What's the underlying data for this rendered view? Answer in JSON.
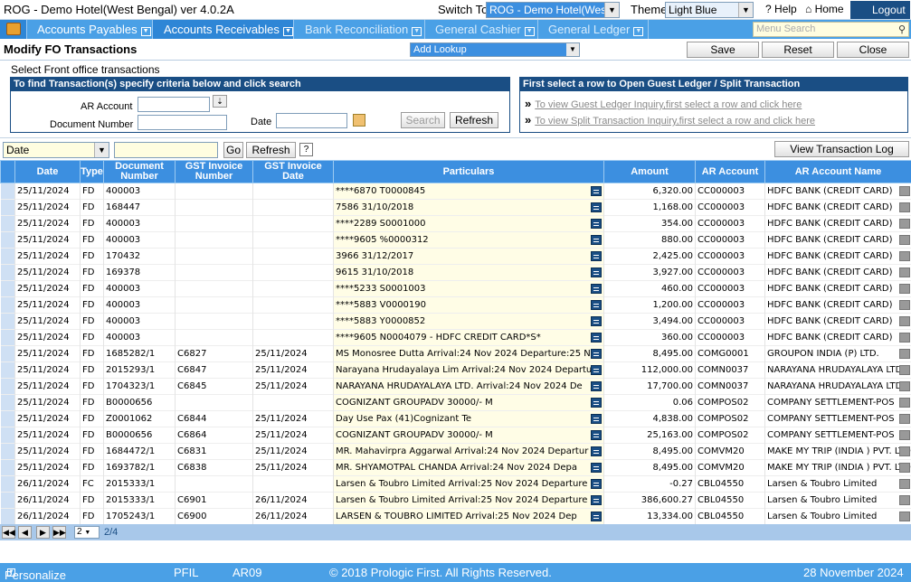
{
  "window": {
    "title": "ROG - Demo Hotel(West Bengal) ver 4.0.2A",
    "switch_to_label": "Switch To",
    "switch_to_value": "ROG - Demo Hotel(West",
    "theme_label": "Theme",
    "theme_value": "Light Blue",
    "help_label": "Help",
    "home_label": "Home",
    "logout_label": "Logout"
  },
  "menu": {
    "items": [
      {
        "label": "Accounts Payables"
      },
      {
        "label": "Accounts Receivables"
      },
      {
        "label": "Bank Reconciliation"
      },
      {
        "label": "General Cashier"
      },
      {
        "label": "General Ledger"
      }
    ],
    "search_placeholder": "Menu Search"
  },
  "page": {
    "title": "Modify FO Transactions",
    "lookup_value": "Add Lookup",
    "save_label": "Save",
    "reset_label": "Reset",
    "close_label": "Close"
  },
  "criteria": {
    "caption": "Select Front office transactions",
    "left_header": "To find Transaction(s) specify criteria below and click search",
    "ar_account_label": "AR Account",
    "document_number_label": "Document Number",
    "date_label": "Date",
    "search_label": "Search",
    "refresh_label": "Refresh",
    "right_header": "First select a row to Open Guest Ledger / Split Transaction",
    "guest_ledger_link": "To view Guest Ledger Inquiry,first select a row and click here",
    "split_link": "To view Split Transaction Inquiry,first select a row and click here"
  },
  "filter": {
    "field_value": "Date",
    "go_label": "Go",
    "refresh_label": "Refresh",
    "help_label": "?",
    "view_log_label": "View Transaction Log"
  },
  "grid": {
    "columns": [
      "Date",
      "Type",
      "Document Number",
      "GST Invoice Number",
      "GST Invoice Date",
      "Particulars",
      "Amount",
      "AR Account",
      "AR Account Name"
    ],
    "rows": [
      [
        "25/11/2024",
        "FD",
        "400003",
        "",
        "",
        "****6870 T0000845",
        "6,320.00",
        "CC000003",
        "HDFC BANK (CREDIT CARD)"
      ],
      [
        "25/11/2024",
        "FD",
        "168447",
        "",
        "",
        "7586 31/10/2018",
        "1,168.00",
        "CC000003",
        "HDFC BANK (CREDIT CARD)"
      ],
      [
        "25/11/2024",
        "FD",
        "400003",
        "",
        "",
        "****2289 S0001000",
        "354.00",
        "CC000003",
        "HDFC BANK (CREDIT CARD)"
      ],
      [
        "25/11/2024",
        "FD",
        "400003",
        "",
        "",
        "****9605 %0000312",
        "880.00",
        "CC000003",
        "HDFC BANK (CREDIT CARD)"
      ],
      [
        "25/11/2024",
        "FD",
        "170432",
        "",
        "",
        "3966 31/12/2017",
        "2,425.00",
        "CC000003",
        "HDFC BANK (CREDIT CARD)"
      ],
      [
        "25/11/2024",
        "FD",
        "169378",
        "",
        "",
        "9615 31/10/2018",
        "3,927.00",
        "CC000003",
        "HDFC BANK (CREDIT CARD)"
      ],
      [
        "25/11/2024",
        "FD",
        "400003",
        "",
        "",
        "****5233 S0001003",
        "460.00",
        "CC000003",
        "HDFC BANK (CREDIT CARD)"
      ],
      [
        "25/11/2024",
        "FD",
        "400003",
        "",
        "",
        "****5883 V0000190",
        "1,200.00",
        "CC000003",
        "HDFC BANK (CREDIT CARD)"
      ],
      [
        "25/11/2024",
        "FD",
        "400003",
        "",
        "",
        "****5883 Y0000852",
        "3,494.00",
        "CC000003",
        "HDFC BANK (CREDIT CARD)"
      ],
      [
        "25/11/2024",
        "FD",
        "400003",
        "",
        "",
        "****9605 N0004079 - HDFC CREDIT CARD*S*",
        "360.00",
        "CC000003",
        "HDFC BANK (CREDIT CARD)"
      ],
      [
        "25/11/2024",
        "FD",
        "1685282/1",
        "C6827",
        "25/11/2024",
        "MS Monosree Dutta Arrival:24 Nov 2024  Departure:25 N",
        "8,495.00",
        "COMG0001",
        "GROUPON INDIA (P) LTD."
      ],
      [
        "25/11/2024",
        "FD",
        "2015293/1",
        "C6847",
        "25/11/2024",
        "Narayana Hrudayalaya Lim Arrival:24 Nov 2024  Departu",
        "112,000.00",
        "COMN0037",
        "NARAYANA HRUDAYALAYA LTD"
      ],
      [
        "25/11/2024",
        "FD",
        "1704323/1",
        "C6845",
        "25/11/2024",
        "NARAYANA HRUDAYALAYA LTD. Arrival:24 Nov 2024  De",
        "17,700.00",
        "COMN0037",
        "NARAYANA HRUDAYALAYA LTD"
      ],
      [
        "25/11/2024",
        "FD",
        "B0000656",
        "",
        "",
        "COGNIZANT GROUPADV 30000/- M",
        "0.06",
        "COMPOS02",
        "COMPANY SETTLEMENT-POS"
      ],
      [
        "25/11/2024",
        "FD",
        "Z0001062",
        "C6844",
        "25/11/2024",
        "Day Use Pax (41)Cognizant Te",
        "4,838.00",
        "COMPOS02",
        "COMPANY SETTLEMENT-POS"
      ],
      [
        "25/11/2024",
        "FD",
        "B0000656",
        "C6864",
        "25/11/2024",
        "COGNIZANT GROUPADV 30000/- M",
        "25,163.00",
        "COMPOS02",
        "COMPANY SETTLEMENT-POS"
      ],
      [
        "25/11/2024",
        "FD",
        "1684472/1",
        "C6831",
        "25/11/2024",
        "MR. Mahavirpra Aggarwal Arrival:24 Nov 2024  Departur",
        "8,495.00",
        "COMVM20",
        "MAKE MY TRIP (INDIA ) PVT. LTD"
      ],
      [
        "25/11/2024",
        "FD",
        "1693782/1",
        "C6838",
        "25/11/2024",
        "MR. SHYAMOTPAL CHANDA Arrival:24 Nov 2024  Depa",
        "8,495.00",
        "COMVM20",
        "MAKE MY TRIP (INDIA ) PVT. LTD"
      ],
      [
        "26/11/2024",
        "FC",
        "2015333/1",
        "",
        "",
        "Larsen & Toubro Limited Arrival:25 Nov 2024  Departure",
        "-0.27",
        "CBL04550",
        "Larsen & Toubro Limited"
      ],
      [
        "26/11/2024",
        "FD",
        "2015333/1",
        "C6901",
        "26/11/2024",
        "Larsen & Toubro Limited Arrival:25 Nov 2024  Departure",
        "386,600.27",
        "CBL04550",
        "Larsen & Toubro Limited"
      ],
      [
        "26/11/2024",
        "FD",
        "1705243/1",
        "C6900",
        "26/11/2024",
        "LARSEN & TOUBRO LIMITED Arrival:25 Nov 2024  Dep",
        "13,334.00",
        "CBL04550",
        "Larsen & Toubro Limited"
      ]
    ]
  },
  "pager": {
    "current_page": "2",
    "page_count": "2/4"
  },
  "footer": {
    "personalize_label": "Personalize",
    "module": "PFIL",
    "report_code": "AR09",
    "copyright": "© 2018 Prologic First. All Rights Reserved.",
    "date": "28 November 2024"
  }
}
